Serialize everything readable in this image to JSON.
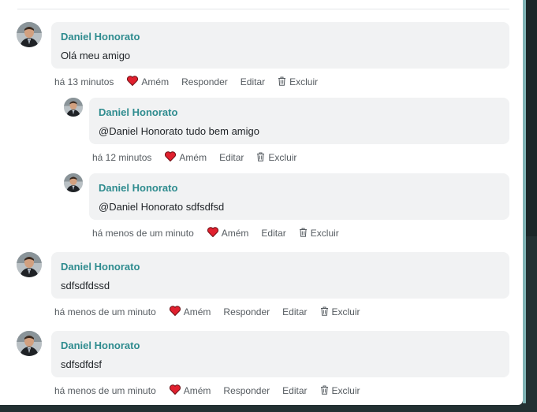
{
  "comments": [
    {
      "author": "Daniel Honorato",
      "text": "Olá meu amigo",
      "time": "há 13 minutos",
      "amen_label": "Amém",
      "reply_label": "Responder",
      "edit_label": "Editar",
      "delete_label": "Excluir",
      "replies": [
        {
          "author": "Daniel Honorato",
          "text": "@Daniel Honorato tudo bem amigo",
          "time": "há 12 minutos",
          "amen_label": "Amém",
          "edit_label": "Editar",
          "delete_label": "Excluir"
        },
        {
          "author": "Daniel Honorato",
          "text": "@Daniel Honorato sdfsdfsd",
          "time": "há menos de um minuto",
          "amen_label": "Amém",
          "edit_label": "Editar",
          "delete_label": "Excluir"
        }
      ]
    },
    {
      "author": "Daniel Honorato",
      "text": "sdfsdfdssd",
      "time": "há menos de um minuto",
      "amen_label": "Amém",
      "reply_label": "Responder",
      "edit_label": "Editar",
      "delete_label": "Excluir"
    },
    {
      "author": "Daniel Honorato",
      "text": "sdfsdfdsf",
      "time": "há menos de um minuto",
      "amen_label": "Amém",
      "reply_label": "Responder",
      "edit_label": "Editar",
      "delete_label": "Excluir"
    }
  ],
  "colors": {
    "author": "#2f8c8f",
    "heart": "#e0202e",
    "bubble": "#f1f2f3",
    "accent_bar": "#7fb3b5"
  },
  "icons": {
    "like": "heart-icon",
    "delete": "trash-icon",
    "avatar": "user-avatar"
  }
}
